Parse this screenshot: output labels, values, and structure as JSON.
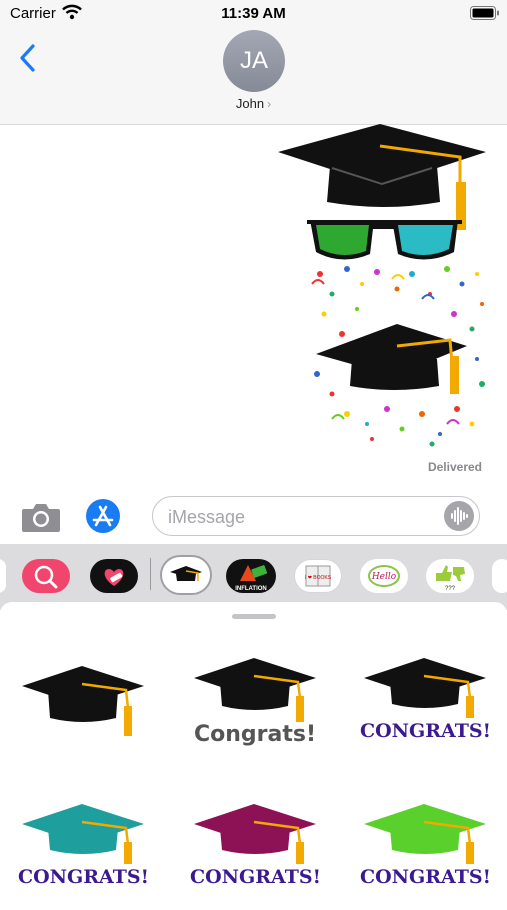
{
  "status_bar": {
    "carrier": "Carrier",
    "time": "11:39 AM"
  },
  "header": {
    "avatar_initials": "JA",
    "contact_name": "John",
    "chevron": "›"
  },
  "message": {
    "status": "Delivered"
  },
  "input": {
    "placeholder": "iMessage"
  },
  "drawer": {
    "apps": [
      "photo-search-app-icon",
      "heart-sticker-app-icon",
      "graduation-cap-app-icon",
      "inflation-app-icon",
      "books-app-icon",
      "hello-app-icon",
      "thumbs-app-icon"
    ],
    "labels": {
      "inflation": "INFLATION",
      "books": "I ❤ BOOKS",
      "hello": "Hello",
      "thumbs": "???"
    }
  },
  "stickers": [
    {
      "caption": "",
      "cap_color": "#111111"
    },
    {
      "caption": "Congrats!",
      "cap_color": "#111111"
    },
    {
      "caption": "CONGRATS!",
      "cap_color": "#111111"
    },
    {
      "caption": "CONGRATS!",
      "cap_color": "#1e9e9c"
    },
    {
      "caption": "CONGRATS!",
      "cap_color": "#8d1255"
    },
    {
      "caption": "CONGRATS!",
      "cap_color": "#5ad02c"
    }
  ],
  "colors": {
    "ios_blue": "#1a7cf2",
    "tassel": "#f2a900",
    "caption_purple": "#3b1a8f",
    "caption_gray": "#555555"
  }
}
